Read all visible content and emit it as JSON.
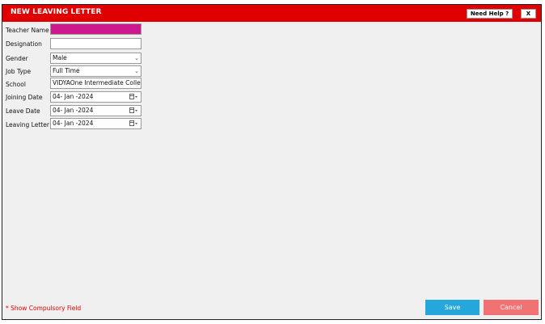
{
  "header": {
    "title": "NEW LEAVING LETTER",
    "help_label": "Need Help ?",
    "close_label": "X"
  },
  "form": {
    "teacher_name": {
      "label": "Teacher Name",
      "value": ""
    },
    "designation": {
      "label": "Designation",
      "value": ""
    },
    "gender": {
      "label": "Gender",
      "value": "Male"
    },
    "job_type": {
      "label": "Job Type",
      "value": "Full Time"
    },
    "school": {
      "label": "School",
      "value": "VIDYAOne Intermediate College"
    },
    "joining_date": {
      "label": "Joining Date",
      "value": "04- Jan -2024"
    },
    "leave_date": {
      "label": "Leave Date",
      "value": "04- Jan -2024"
    },
    "leaving_letter": {
      "label": "Leaving Letter",
      "value": "04- Jan -2024"
    }
  },
  "footer": {
    "required_note": "* Show Compulsory Field",
    "save_label": "Save",
    "cancel_label": "Cancel"
  },
  "colors": {
    "header_red": "#e00000",
    "highlight_pink": "#cc1a8e",
    "save_blue": "#26a7dc",
    "cancel_red": "#f07272"
  }
}
